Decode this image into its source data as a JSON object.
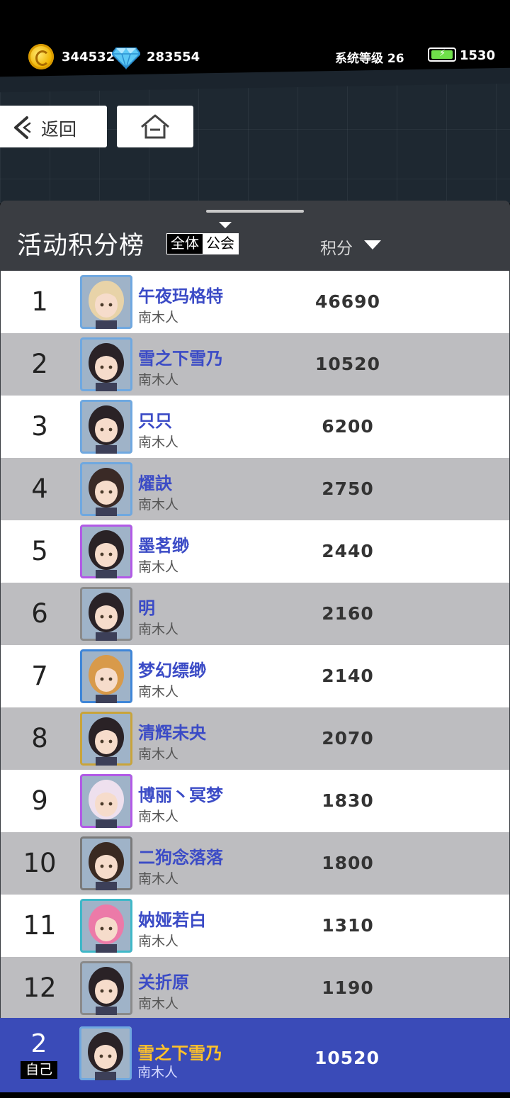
{
  "status": {
    "gold": "344532",
    "diamond": "283554",
    "system_level": "系统等级 26",
    "energy": "1530"
  },
  "nav": {
    "back_label": "返回"
  },
  "board": {
    "title": "活动积分榜",
    "tabs": [
      "全体",
      "公会"
    ],
    "score_header": "积分"
  },
  "rows": [
    {
      "rank": "1",
      "name": "午夜玛格特",
      "guild": "南木人",
      "score": "46690"
    },
    {
      "rank": "2",
      "name": "雪之下雪乃",
      "guild": "南木人",
      "score": "10520"
    },
    {
      "rank": "3",
      "name": "只只",
      "guild": "南木人",
      "score": "6200"
    },
    {
      "rank": "4",
      "name": "燿訣",
      "guild": "南木人",
      "score": "2750"
    },
    {
      "rank": "5",
      "name": "墨茗缈",
      "guild": "南木人",
      "score": "2440"
    },
    {
      "rank": "6",
      "name": "明",
      "guild": "南木人",
      "score": "2160"
    },
    {
      "rank": "7",
      "name": "梦幻缥缈",
      "guild": "南木人",
      "score": "2140"
    },
    {
      "rank": "8",
      "name": "清辉未央",
      "guild": "南木人",
      "score": "2070"
    },
    {
      "rank": "9",
      "name": "博丽丶冥梦",
      "guild": "南木人",
      "score": "1830"
    },
    {
      "rank": "10",
      "name": "二狗念落落",
      "guild": "南木人",
      "score": "1800"
    },
    {
      "rank": "11",
      "name": "妠娅若白",
      "guild": "南木人",
      "score": "1310"
    },
    {
      "rank": "12",
      "name": "关折原",
      "guild": "南木人",
      "score": "1190"
    }
  ],
  "self": {
    "rank": "2",
    "badge": "自己",
    "name": "雪之下雪乃",
    "guild": "南木人",
    "score": "10520"
  },
  "colors": {
    "name_blue": "#3b4bc6",
    "self_row_bg": "#3a4bb8",
    "self_name": "#ffc229"
  }
}
